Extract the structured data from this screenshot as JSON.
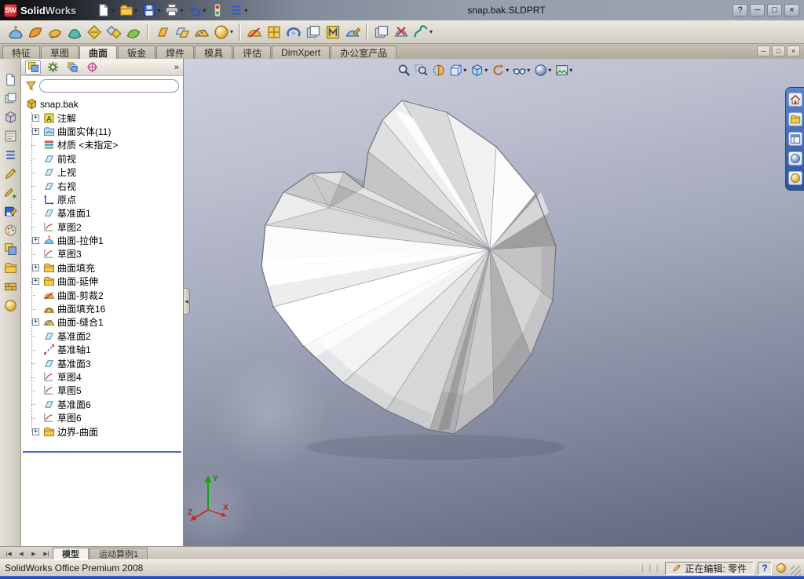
{
  "glyphs": {
    "caret": "▾",
    "plus": "+",
    "chevrons": "»",
    "collapse": "◀"
  },
  "titlebar": {
    "logo_text": "SW",
    "app_name_bold": "Solid",
    "app_name_light": "Works",
    "document_title": "snap.bak.SLDPRT",
    "window_buttons": [
      "?",
      "─",
      "□",
      "×"
    ]
  },
  "toolbar_standard": [
    {
      "name": "new-document-button",
      "icon": "page",
      "dropdown": true
    },
    {
      "name": "open-button",
      "icon": "folder",
      "dropdown": true
    },
    {
      "name": "save-button",
      "icon": "floppy",
      "dropdown": true
    },
    {
      "name": "print-button",
      "icon": "printer",
      "dropdown": true
    },
    {
      "name": "undo-button",
      "icon": "undo",
      "dropdown": true
    },
    {
      "name": "rebuild-button",
      "icon": "reddot",
      "dropdown": false
    },
    {
      "name": "options-button",
      "icon": "list",
      "dropdown": true
    }
  ],
  "surfaces_toolbar": [
    {
      "name": "extruded-surface-button",
      "icon": "surfBlue"
    },
    {
      "name": "revolved-surface-button",
      "icon": "surfOrange"
    },
    {
      "name": "swept-surface-button",
      "icon": "surfGold"
    },
    {
      "name": "lofted-surface-button",
      "icon": "surfTeal"
    },
    {
      "name": "boundary-surface-button",
      "icon": "diamondGold"
    },
    {
      "name": "offset-surface-button",
      "icon": "diamondPair"
    },
    {
      "name": "radiate-surface-button",
      "icon": "surfGreen"
    },
    {
      "sep": true
    },
    {
      "name": "planar-surface-button",
      "icon": "planeOrange"
    },
    {
      "name": "extend-surface-button",
      "icon": "planes"
    },
    {
      "name": "knit-surface-button",
      "icon": "surfKnit"
    },
    {
      "name": "fillet-button",
      "icon": "ballGold",
      "dropdown": true
    },
    {
      "sep": true
    },
    {
      "name": "trim-surface-button",
      "icon": "surfTrim"
    },
    {
      "name": "untrim-surface-button",
      "icon": "box"
    },
    {
      "name": "delete-face-button",
      "icon": "swirl"
    },
    {
      "name": "replace-face-button",
      "icon": "sheets"
    },
    {
      "name": "mid-surface-button",
      "icon": "mform"
    },
    {
      "name": "freeform-button",
      "icon": "pencilBlue"
    },
    {
      "sep": true
    },
    {
      "name": "thicken-button",
      "icon": "sheets"
    },
    {
      "name": "cut-with-surface-button",
      "icon": "cutx"
    },
    {
      "name": "curves-button",
      "icon": "curve2",
      "dropdown": true
    }
  ],
  "command_tabs": [
    {
      "name": "tab-features",
      "label": "特征"
    },
    {
      "name": "tab-sketch",
      "label": "草图"
    },
    {
      "name": "tab-surfaces",
      "label": "曲面",
      "active": true
    },
    {
      "name": "tab-sheet-metal",
      "label": "钣金"
    },
    {
      "name": "tab-weldments",
      "label": "焊件"
    },
    {
      "name": "tab-mold-tools",
      "label": "模具"
    },
    {
      "name": "tab-evaluate",
      "label": "评估"
    },
    {
      "name": "tab-dimxpert",
      "label": "DimXpert"
    },
    {
      "name": "tab-office-products",
      "label": "办公室产品"
    }
  ],
  "doc_window_buttons": [
    "─",
    "□",
    "×"
  ],
  "left_toolbar": [
    {
      "name": "document-button",
      "icon": "page"
    },
    {
      "name": "sheets-button",
      "icon": "sheets"
    },
    {
      "name": "part-box-button",
      "icon": "cubeGray"
    },
    {
      "name": "board-button",
      "icon": "board"
    },
    {
      "name": "notes-button",
      "icon": "list"
    },
    {
      "name": "pencil-button",
      "icon": "pencil"
    },
    {
      "name": "pencil-add-button",
      "icon": "pencilPlus"
    },
    {
      "name": "save-annotation-button",
      "icon": "saveNote"
    },
    {
      "name": "palette-button",
      "icon": "palette"
    },
    {
      "name": "layers-button",
      "icon": "fmTree"
    },
    {
      "name": "library-button",
      "icon": "folder"
    },
    {
      "name": "block-button",
      "icon": "brick"
    },
    {
      "name": "sphere-button",
      "icon": "ballGold"
    }
  ],
  "feature_manager": {
    "tabs": [
      {
        "name": "featuremanager-tab",
        "icon": "fmTree",
        "active": true
      },
      {
        "name": "propertymanager-tab",
        "icon": "gear"
      },
      {
        "name": "configurationmanager-tab",
        "icon": "configs"
      },
      {
        "name": "dimxpertmanager-tab",
        "icon": "target"
      }
    ],
    "filter_placeholder": ""
  },
  "feature_tree": {
    "root": {
      "label": "snap.bak"
    },
    "items": [
      {
        "name": "tree-item-annotations",
        "label": "注解",
        "icon": "annA",
        "expand": true
      },
      {
        "name": "tree-item-surface-bodies",
        "label": "曲面实体(11)",
        "icon": "bodies",
        "expand": true
      },
      {
        "name": "tree-item-material",
        "label": "材质 <未指定>",
        "icon": "material"
      },
      {
        "name": "tree-item-front-plane",
        "label": "前视",
        "icon": "plane"
      },
      {
        "name": "tree-item-top-plane",
        "label": "上视",
        "icon": "plane"
      },
      {
        "name": "tree-item-right-plane",
        "label": "右视",
        "icon": "plane"
      },
      {
        "name": "tree-item-origin",
        "label": "原点",
        "icon": "origin"
      },
      {
        "name": "tree-item-plane1",
        "label": "基准面1",
        "icon": "plane"
      },
      {
        "name": "tree-item-sketch2",
        "label": "草图2",
        "icon": "sketch"
      },
      {
        "name": "tree-item-surface-extrude1",
        "label": "曲面-拉伸1",
        "icon": "surfExtrude",
        "expand": true
      },
      {
        "name": "tree-item-sketch3",
        "label": "草图3",
        "icon": "sketch"
      },
      {
        "name": "tree-item-surface-fill-folder",
        "label": "曲面填充",
        "icon": "folder",
        "expand": true
      },
      {
        "name": "tree-item-surface-extend-folder",
        "label": "曲面-延伸",
        "icon": "folder",
        "expand": true
      },
      {
        "name": "tree-item-surface-trim2",
        "label": "曲面-剪裁2",
        "icon": "surfTrim"
      },
      {
        "name": "tree-item-surface-fill16",
        "label": "曲面填充16",
        "icon": "surfFill"
      },
      {
        "name": "tree-item-surface-knit1",
        "label": "曲面-缝合1",
        "icon": "surfKnit",
        "expand": true
      },
      {
        "name": "tree-item-plane2",
        "label": "基准面2",
        "icon": "plane"
      },
      {
        "name": "tree-item-axis1",
        "label": "基准轴1",
        "icon": "axis"
      },
      {
        "name": "tree-item-plane3",
        "label": "基准面3",
        "icon": "plane"
      },
      {
        "name": "tree-item-sketch4",
        "label": "草图4",
        "icon": "sketch"
      },
      {
        "name": "tree-item-sketch5",
        "label": "草图5",
        "icon": "sketch"
      },
      {
        "name": "tree-item-plane6",
        "label": "基准面6",
        "icon": "plane"
      },
      {
        "name": "tree-item-sketch6",
        "label": "草图6",
        "icon": "sketch"
      },
      {
        "name": "tree-item-boundary-surface",
        "label": "边界-曲面",
        "icon": "folder",
        "expand": true
      }
    ]
  },
  "view_toolbar": [
    {
      "name": "zoom-to-fit-button",
      "icon": "magnifier"
    },
    {
      "name": "zoom-to-area-button",
      "icon": "magnifierArea"
    },
    {
      "name": "section-view-button",
      "icon": "section"
    },
    {
      "name": "view-orientation-button",
      "icon": "cubeViews",
      "dropdown": true
    },
    {
      "name": "display-style-button",
      "icon": "displayStyle",
      "dropdown": true
    },
    {
      "name": "rotate-view-button",
      "icon": "rotate",
      "dropdown": true
    },
    {
      "name": "hide-show-items-button",
      "icon": "glasses",
      "dropdown": true
    },
    {
      "name": "appearances-button",
      "icon": "ballShaded",
      "dropdown": true
    },
    {
      "name": "scene-button",
      "icon": "scene",
      "dropdown": true
    }
  ],
  "task_pane": [
    {
      "name": "solidworks-resources-button",
      "icon": "house"
    },
    {
      "name": "design-library-button",
      "icon": "folder"
    },
    {
      "name": "file-explorer-button",
      "icon": "explorer"
    },
    {
      "name": "view-palette-button",
      "icon": "ballShaded"
    },
    {
      "name": "appearances-scenes-button",
      "icon": "ballGold"
    }
  ],
  "bottom_nav": [
    "|◀",
    "◀",
    "▶",
    "▶|"
  ],
  "bottom_tabs": [
    {
      "name": "model-tab",
      "label": "模型",
      "active": true
    },
    {
      "name": "motion-study-tab",
      "label": "运动算例1"
    }
  ],
  "status_bar": {
    "product": "SolidWorks Office Premium 2008",
    "editing": "正在编辑: 零件",
    "help": "?"
  },
  "triad": {
    "x": "X",
    "y": "Y",
    "z": "Z"
  }
}
